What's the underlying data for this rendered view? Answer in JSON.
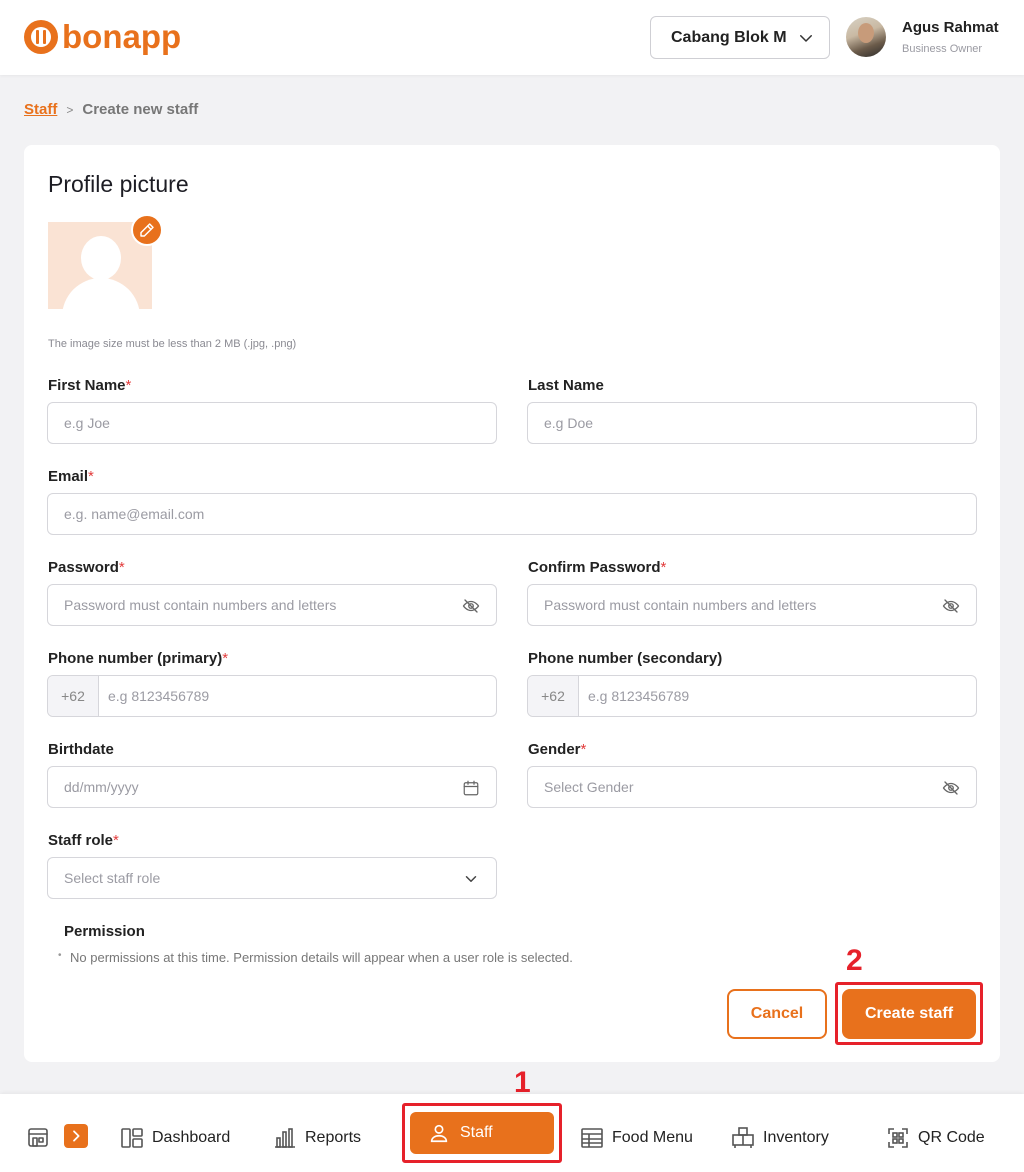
{
  "brand": {
    "name": "bonapp",
    "accent": "#e8711c"
  },
  "header": {
    "branch": "Cabang Blok M",
    "user_name": "Agus Rahmat",
    "user_role": "Business Owner"
  },
  "breadcrumb": {
    "parent": "Staff",
    "separator": ">",
    "current": "Create new staff"
  },
  "form": {
    "section_title": "Profile picture",
    "image_hint": "The image size must be less than 2 MB (.jpg, .png)",
    "required_mark": "*",
    "first_name": {
      "label": "First Name",
      "placeholder": "e.g Joe"
    },
    "last_name": {
      "label": "Last Name",
      "placeholder": "e.g Doe"
    },
    "email": {
      "label": "Email",
      "placeholder": "e.g. name@email.com"
    },
    "password": {
      "label": "Password",
      "placeholder": "Password must contain numbers and letters"
    },
    "confirm_password": {
      "label": "Confirm Password",
      "placeholder": "Password must contain numbers and letters"
    },
    "phone_primary": {
      "label": "Phone number (primary)",
      "prefix": "+62",
      "placeholder": "e.g 8123456789"
    },
    "phone_secondary": {
      "label": "Phone number (secondary)",
      "prefix": "+62",
      "placeholder": "e.g 8123456789"
    },
    "birthdate": {
      "label": "Birthdate",
      "placeholder": "dd/mm/yyyy"
    },
    "gender": {
      "label": "Gender",
      "placeholder": "Select Gender"
    },
    "staff_role": {
      "label": "Staff role",
      "placeholder": "Select staff role"
    },
    "permission": {
      "title": "Permission",
      "note": "No permissions at this time. Permission details will appear when a user role is selected."
    },
    "cancel_label": "Cancel",
    "create_label": "Create staff"
  },
  "annotations": {
    "first": "1",
    "second": "2",
    "color": "#e6212a"
  },
  "bottom_nav": {
    "items": [
      {
        "label": "Dashboard",
        "icon": "dashboard-icon"
      },
      {
        "label": "Reports",
        "icon": "bar-chart-icon"
      },
      {
        "label": "Staff",
        "icon": "user-icon",
        "active": true
      },
      {
        "label": "Food Menu",
        "icon": "food-menu-icon"
      },
      {
        "label": "Inventory",
        "icon": "inventory-icon"
      },
      {
        "label": "QR Code",
        "icon": "qr-code-icon"
      }
    ]
  }
}
